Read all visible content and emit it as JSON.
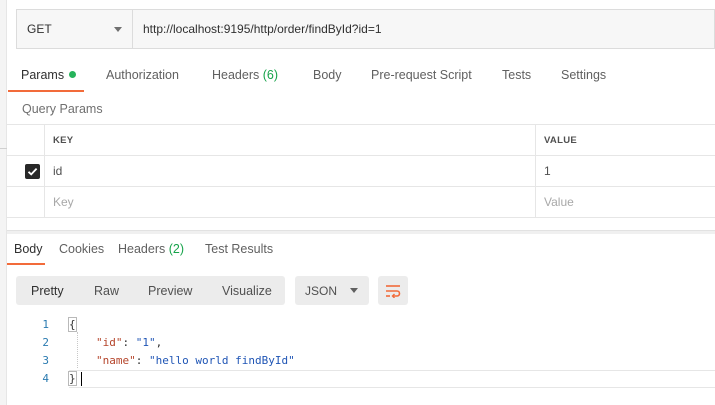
{
  "request": {
    "method": "GET",
    "url": "http://localhost:9195/http/order/findById?id=1"
  },
  "request_tabs": {
    "params": "Params",
    "authorization": "Authorization",
    "headers": "Headers",
    "headers_count": "(6)",
    "body": "Body",
    "prerequest": "Pre-request Script",
    "tests": "Tests",
    "settings": "Settings"
  },
  "query_params": {
    "title": "Query Params",
    "columns": {
      "key": "KEY",
      "value": "VALUE"
    },
    "rows": [
      {
        "checked": true,
        "key": "id",
        "value": "1"
      }
    ],
    "placeholders": {
      "key": "Key",
      "value": "Value"
    }
  },
  "response_tabs": {
    "body": "Body",
    "cookies": "Cookies",
    "headers": "Headers",
    "headers_count": "(2)",
    "test_results": "Test Results"
  },
  "view_modes": {
    "pretty": "Pretty",
    "raw": "Raw",
    "preview": "Preview",
    "visualize": "Visualize"
  },
  "format": "JSON",
  "code": {
    "line_numbers": [
      "1",
      "2",
      "3",
      "4"
    ],
    "open_brace": "{",
    "close_brace": "}",
    "line2": {
      "key": "\"id\"",
      "sep": ": ",
      "value": "\"1\"",
      "end": ","
    },
    "line3": {
      "key": "\"name\"",
      "sep": ": ",
      "value": "\"hello world findById\""
    }
  },
  "colors": {
    "accent": "#f26b3a",
    "indicator": "#26b35b",
    "count": "#16a34a",
    "json_key": "#b5452b",
    "json_string": "#1f55b5",
    "line_number": "#2a7ab0"
  }
}
